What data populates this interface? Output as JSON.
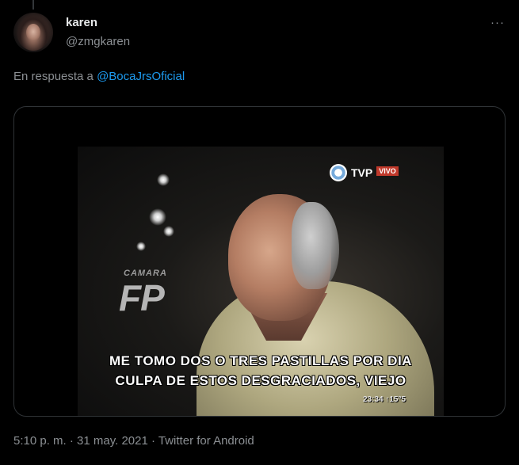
{
  "tweet": {
    "display_name": "karen",
    "handle": "@zmgkaren",
    "more_icon": "more-horizontal-icon",
    "more_glyph": "···",
    "reply_prefix": "En respuesta a",
    "reply_mention": "@BocaJrsOficial",
    "media": {
      "watermark_small": "CAMARA",
      "watermark_large": "FP",
      "channel": "TVP",
      "live_badge": "VIVO",
      "subtitle_line1": "ME TOMO DOS O TRES PASTILLAS POR DIA",
      "subtitle_line2": "CULPA DE ESTOS DESGRACIADOS, VIEJO",
      "clock": "23:34 ↑15°5"
    },
    "time": "5:10 p. m.",
    "separator1": " · ",
    "date": "31 may. 2021",
    "separator2": " · ",
    "source": "Twitter for Android"
  },
  "colors": {
    "background": "#000000",
    "primary_text": "#e7e9ea",
    "secondary_text": "#8b8f93",
    "link": "#1d9bf0",
    "border": "#2f3336"
  }
}
